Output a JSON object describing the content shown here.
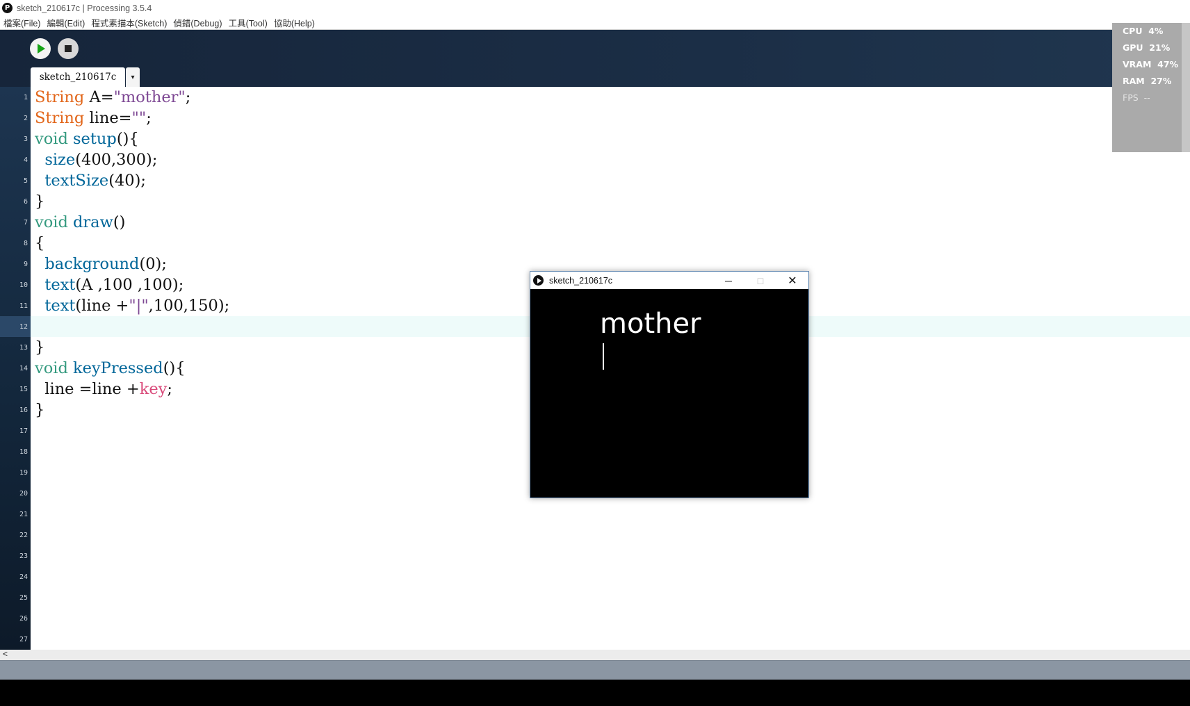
{
  "window": {
    "title": "sketch_210617c | Processing 3.5.4",
    "logo_glyph": "P"
  },
  "menu": [
    "檔案(File)",
    "編輯(Edit)",
    "程式素描本(Sketch)",
    "偵錯(Debug)",
    "工具(Tool)",
    "協助(Help)"
  ],
  "toolbar": {
    "run_icon": "play-icon",
    "stop_icon": "stop-icon"
  },
  "tab": {
    "label": "sketch_210617c",
    "dropdown_glyph": "▾"
  },
  "editor": {
    "line_numbers": [
      "1",
      "2",
      "3",
      "4",
      "5",
      "6",
      "7",
      "8",
      "9",
      "10",
      "11",
      "12",
      "13",
      "14",
      "15",
      "16",
      "17",
      "18",
      "19",
      "20",
      "21",
      "22",
      "23",
      "24",
      "25",
      "26",
      "27"
    ],
    "current_line": "12",
    "code": [
      [
        [
          "t",
          "String"
        ],
        [
          "p",
          " A="
        ],
        [
          "s",
          "\"mother\""
        ],
        [
          "p",
          ";"
        ]
      ],
      [
        [
          "t",
          "String"
        ],
        [
          "p",
          " line="
        ],
        [
          "s",
          "\"\""
        ],
        [
          "p",
          ";"
        ]
      ],
      [
        [
          "v",
          "void"
        ],
        [
          "p",
          " "
        ],
        [
          "f",
          "setup"
        ],
        [
          "p",
          "(){"
        ]
      ],
      [
        [
          "p",
          "  "
        ],
        [
          "f",
          "size"
        ],
        [
          "p",
          "(400,300);"
        ]
      ],
      [
        [
          "p",
          "  "
        ],
        [
          "f",
          "textSize"
        ],
        [
          "p",
          "(40);"
        ]
      ],
      [
        [
          "p",
          "}"
        ]
      ],
      [
        [
          "v",
          "void"
        ],
        [
          "p",
          " "
        ],
        [
          "f",
          "draw"
        ],
        [
          "p",
          "()"
        ]
      ],
      [
        [
          "p",
          "{"
        ]
      ],
      [
        [
          "p",
          "  "
        ],
        [
          "f",
          "background"
        ],
        [
          "p",
          "(0);"
        ]
      ],
      [
        [
          "p",
          "  "
        ],
        [
          "f",
          "text"
        ],
        [
          "p",
          "(A ,100 ,100);"
        ]
      ],
      [
        [
          "p",
          "  "
        ],
        [
          "f",
          "text"
        ],
        [
          "p",
          "(line +"
        ],
        [
          "s",
          "\"|\""
        ],
        [
          "p",
          ",100,150);"
        ]
      ],
      [
        [
          "p",
          ""
        ]
      ],
      [
        [
          "p",
          "}"
        ]
      ],
      [
        [
          "v",
          "void"
        ],
        [
          "p",
          " "
        ],
        [
          "f",
          "keyPressed"
        ],
        [
          "p",
          "(){"
        ]
      ],
      [
        [
          "p",
          "  line =line +"
        ],
        [
          "k",
          "key"
        ],
        [
          "p",
          ";"
        ]
      ],
      [
        [
          "p",
          "}"
        ]
      ]
    ]
  },
  "sketch_window": {
    "title": "sketch_210617c",
    "minimize": "─",
    "maximize": "□",
    "close": "✕",
    "canvas_text": "mother"
  },
  "perf": [
    {
      "label": "CPU",
      "value": "4%"
    },
    {
      "label": "GPU",
      "value": "21%"
    },
    {
      "label": "VRAM",
      "value": "47%"
    },
    {
      "label": "RAM",
      "value": "27%"
    },
    {
      "label": "FPS",
      "value": "--"
    }
  ],
  "scrollbar": {
    "left_arrow": "<"
  },
  "colors": {
    "type_keyword": "#e2661a",
    "void_keyword": "#33997e",
    "function": "#006699",
    "string": "#7d4793",
    "key_var": "#d94a7a",
    "run_green": "#16a316"
  }
}
